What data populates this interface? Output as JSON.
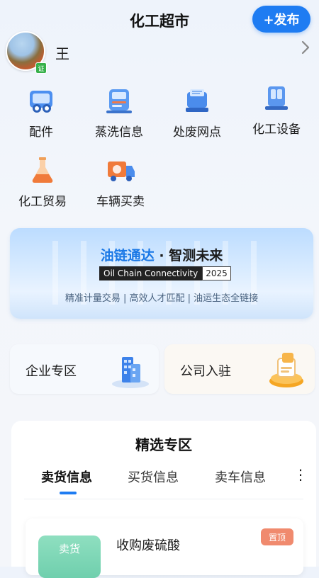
{
  "header": {
    "title": "化工超市",
    "publish_label": "+发布"
  },
  "user": {
    "name": "王",
    "verify_badge": "证"
  },
  "categories": [
    {
      "label": "配件",
      "icon": "parts-icon"
    },
    {
      "label": "蒸洗信息",
      "icon": "steam-wash-icon"
    },
    {
      "label": "处废网点",
      "icon": "waste-disposal-icon"
    },
    {
      "label": "化工设备",
      "icon": "chemical-equipment-icon"
    },
    {
      "label": "化工贸易",
      "icon": "flask-icon"
    },
    {
      "label": "车辆买卖",
      "icon": "truck-icon"
    }
  ],
  "banner": {
    "title_blue": "油链通达",
    "title_sep": "·",
    "title_dark": "智测未来",
    "en": "Oil Chain Connectivity",
    "year": "2025",
    "tagline": "精准计量交易 | 高效人才匹配 | 油运生态全链接"
  },
  "zones": [
    {
      "label": "企业专区",
      "icon": "enterprise-building-icon"
    },
    {
      "label": "公司入驻",
      "icon": "company-join-icon"
    }
  ],
  "featured": {
    "title": "精选专区",
    "tabs": [
      "卖货信息",
      "买货信息",
      "卖车信息"
    ],
    "active_tab": 0,
    "more": "⋮",
    "item": {
      "thumb": "卖货",
      "title": "收购废硫酸",
      "badge": "置顶"
    }
  },
  "colors": {
    "accent": "#1e7cf2",
    "badge": "#f08a6e",
    "thumb": "#7ad6b6"
  }
}
